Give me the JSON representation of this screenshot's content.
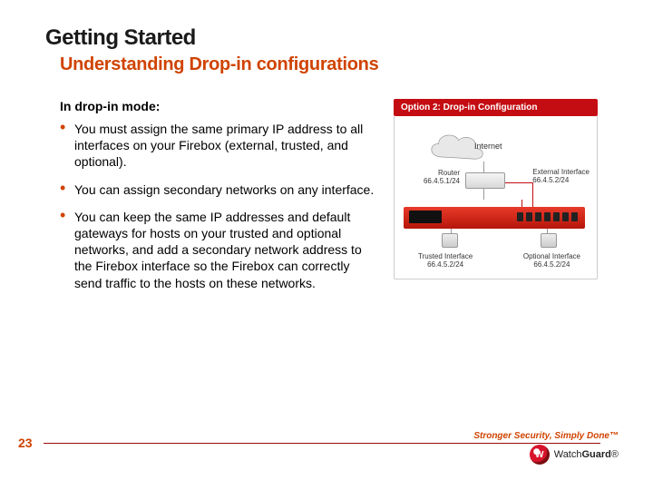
{
  "header": {
    "title": "Getting Started",
    "subtitle": "Understanding Drop-in configurations"
  },
  "intro": "In drop-in mode:",
  "bullets": [
    "You must assign the same primary IP address to all interfaces on your Firebox (external, trusted, and optional).",
    "You can assign secondary networks on any interface.",
    "You can keep the same IP addresses and default gateways for hosts on your trusted and optional networks, and add a secondary network address to the Firebox interface so the Firebox can correctly send traffic to the hosts on these networks."
  ],
  "figure": {
    "header": "Option 2: Drop-in Configuration",
    "internet": "Internet",
    "router_label": "Router",
    "router_ip": "66.4.5.1/24",
    "ext_if_label": "External Interface",
    "ext_if_ip": "66.4.5.2/24",
    "trusted_label": "Trusted Interface",
    "trusted_ip": "66.4.5.2/24",
    "optional_label": "Optional Interface",
    "optional_ip": "66.4.5.2/24"
  },
  "footer": {
    "page_number": "23",
    "tagline": "Stronger Security, Simply Done™",
    "brand_a": "Watch",
    "brand_b": "Guard"
  }
}
